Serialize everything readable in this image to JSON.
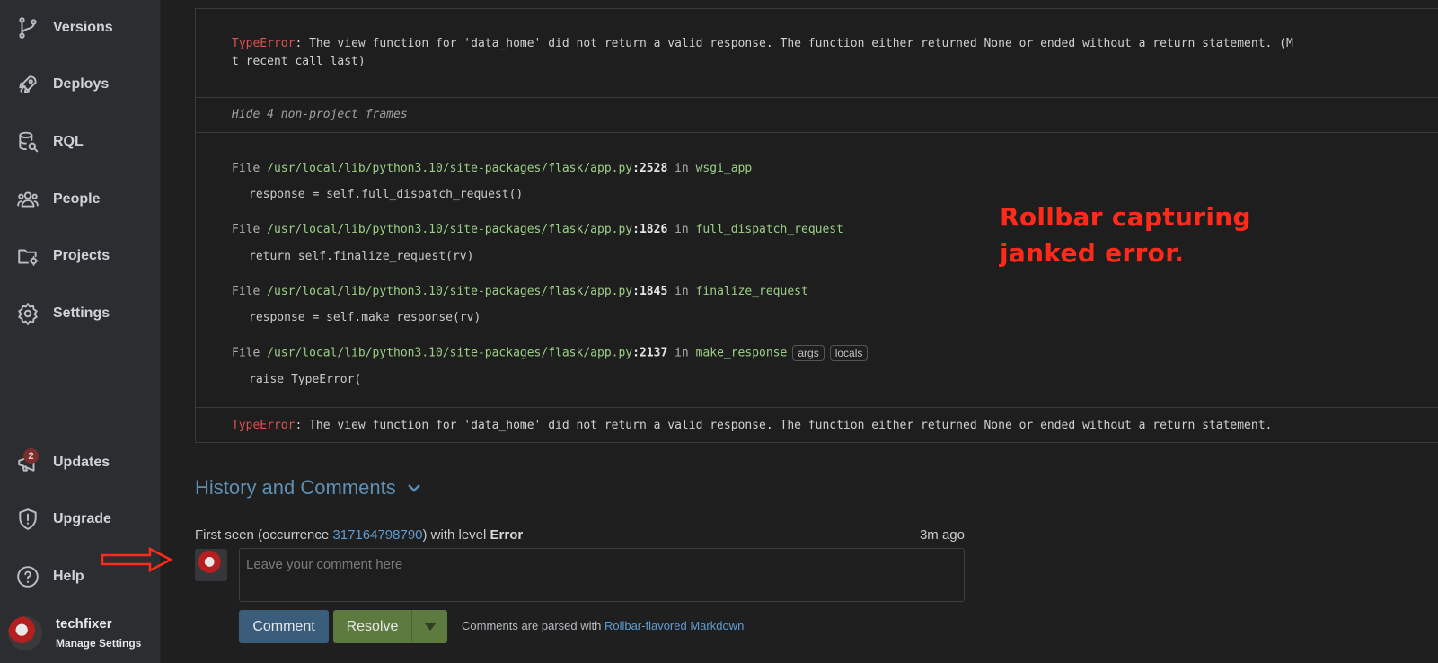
{
  "sidebar": {
    "items": [
      {
        "label": "Versions",
        "icon": "branch-icon"
      },
      {
        "label": "Deploys",
        "icon": "rocket-icon"
      },
      {
        "label": "RQL",
        "icon": "database-search-icon"
      },
      {
        "label": "People",
        "icon": "people-icon"
      },
      {
        "label": "Projects",
        "icon": "folder-gear-icon"
      },
      {
        "label": "Settings",
        "icon": "gear-icon"
      }
    ],
    "bottom_items": [
      {
        "label": "Updates",
        "icon": "megaphone-icon",
        "badge": "2"
      },
      {
        "label": "Upgrade",
        "icon": "shield-icon"
      },
      {
        "label": "Help",
        "icon": "help-icon"
      }
    ],
    "user": {
      "name": "techfixer",
      "sub": "Manage Settings"
    }
  },
  "trace": {
    "header_error_type": "TypeError",
    "header_error_msg": ": The view function for 'data_home' did not return a valid response. The function either returned None or ended without a return statement. (M",
    "header_error_msg_cont": "t recent call last)",
    "hide_frames": "Hide 4 non-project frames",
    "frames": [
      {
        "file_kw": "File",
        "path": "/usr/local/lib/python3.10/site-packages/flask/app.py",
        "line": ":2528",
        "in": "in",
        "fn": "wsgi_app",
        "code": "response = self.full_dispatch_request()"
      },
      {
        "file_kw": "File",
        "path": "/usr/local/lib/python3.10/site-packages/flask/app.py",
        "line": ":1826",
        "in": "in",
        "fn": "full_dispatch_request",
        "code": "return self.finalize_request(rv)"
      },
      {
        "file_kw": "File",
        "path": "/usr/local/lib/python3.10/site-packages/flask/app.py",
        "line": ":1845",
        "in": "in",
        "fn": "finalize_request",
        "code": "response = self.make_response(rv)"
      },
      {
        "file_kw": "File",
        "path": "/usr/local/lib/python3.10/site-packages/flask/app.py",
        "line": ":2137",
        "in": "in",
        "fn": "make_response",
        "code": "raise TypeError(",
        "chips": [
          "args",
          "locals"
        ]
      }
    ],
    "footer_error_type": "TypeError",
    "footer_error_msg": ": The view function for 'data_home' did not return a valid response. The function either returned None or ended without a return statement."
  },
  "annotation": {
    "line1": "Rollbar capturing",
    "line2": "janked error."
  },
  "history": {
    "title": "History and Comments",
    "first_seen_prefix": "First seen (occurrence ",
    "occurrence_id": "317164798790",
    "first_seen_mid": ") with level ",
    "level": "Error",
    "time_ago": "3m ago",
    "comment_placeholder": "Leave your comment here",
    "comment_button": "Comment",
    "resolve_button": "Resolve",
    "markdown_prefix": "Comments are parsed with ",
    "markdown_link": "Rollbar-flavored Markdown"
  },
  "colors": {
    "sidebar_bg": "#2b2d31",
    "page_bg": "#1f1f1f",
    "error_red": "#d9534f",
    "path_green": "#9bcf86",
    "link_blue": "#5f9bd0",
    "annotation_red": "#ff2a1a"
  }
}
